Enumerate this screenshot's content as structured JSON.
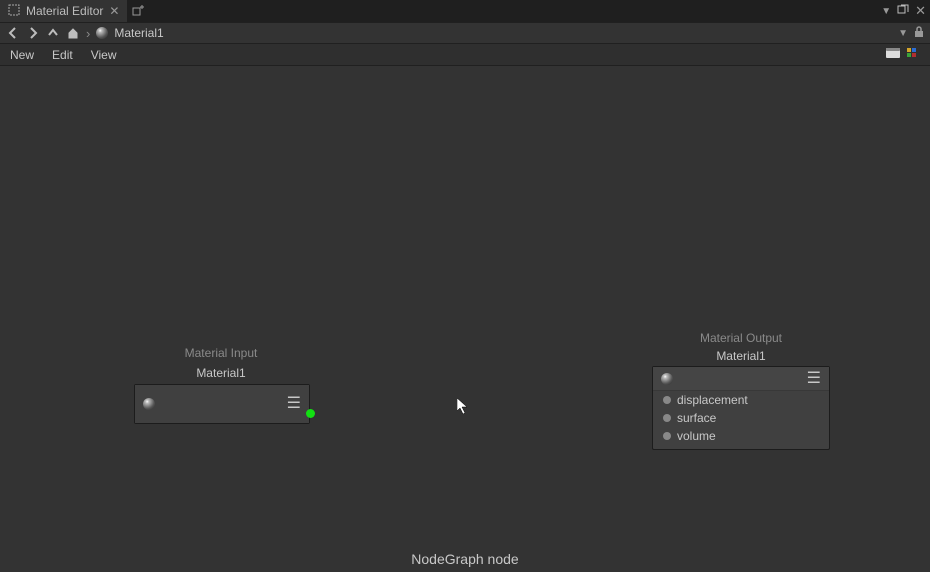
{
  "tab": {
    "title": "Material Editor"
  },
  "breadcrumb": {
    "name": "Material1"
  },
  "menu": {
    "new": "New",
    "edit": "Edit",
    "view": "View"
  },
  "nodes": {
    "input": {
      "type": "Material Input",
      "name": "Material1"
    },
    "output": {
      "type": "Material Output",
      "name": "Material1",
      "sockets": [
        "displacement",
        "surface",
        "volume"
      ]
    }
  },
  "footer": "NodeGraph  node"
}
